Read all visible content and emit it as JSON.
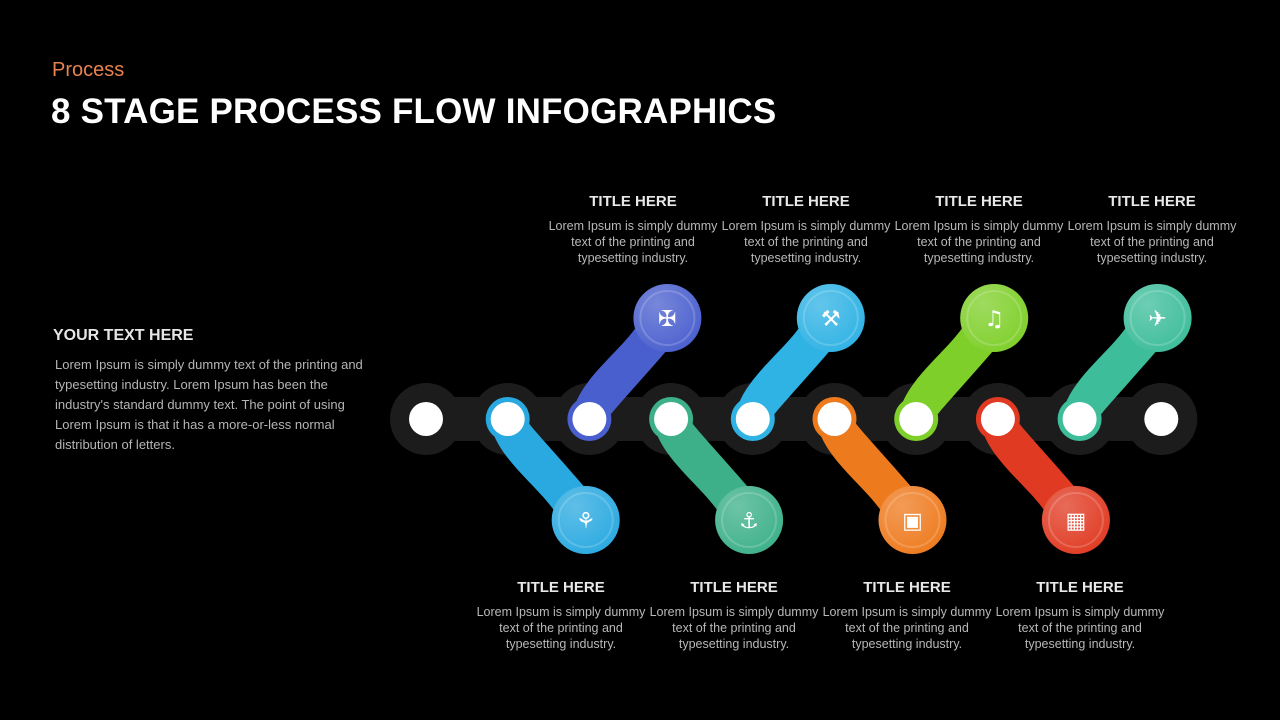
{
  "header": {
    "subtitle": "Process",
    "title": "8 STAGE PROCESS FLOW INFOGRAPHICS"
  },
  "sidebar": {
    "heading": "YOUR TEXT HERE",
    "body": "Lorem Ipsum is simply dummy text of the printing and typesetting industry. Lorem Ipsum has been the industry's standard dummy text. The point of using Lorem Ipsum is that it has a more-or-less normal distribution of letters."
  },
  "stages": [
    {
      "title": "TITLE HERE",
      "body": "Lorem Ipsum is simply dummy text of the printing and typesetting industry.",
      "color": "#2aa9e0",
      "position": "bottom",
      "icon": "plant-in-hand-icon"
    },
    {
      "title": "TITLE HERE",
      "body": "Lorem Ipsum is simply dummy text of the printing and typesetting industry.",
      "color": "#4a5fce",
      "position": "top",
      "icon": "satellite-icon"
    },
    {
      "title": "TITLE HERE",
      "body": "Lorem Ipsum is simply dummy text of the printing and typesetting industry.",
      "color": "#3db08a",
      "position": "bottom",
      "icon": "weightlifter-icon"
    },
    {
      "title": "TITLE HERE",
      "body": "Lorem Ipsum is simply dummy text of the printing and typesetting industry.",
      "color": "#2fb2e4",
      "position": "top",
      "icon": "person-at-desk-icon"
    },
    {
      "title": "TITLE HERE",
      "body": "Lorem Ipsum is simply dummy text of the printing and typesetting industry.",
      "color": "#ee7a1e",
      "position": "bottom",
      "icon": "presentation-icon"
    },
    {
      "title": "TITLE HERE",
      "body": "Lorem Ipsum is simply dummy text of the printing and typesetting industry.",
      "color": "#7fcf2a",
      "position": "top",
      "icon": "megaphone-icon"
    },
    {
      "title": "TITLE HERE",
      "body": "Lorem Ipsum is simply dummy text of the printing and typesetting industry.",
      "color": "#e03a22",
      "position": "bottom",
      "icon": "monitor-chart-icon"
    },
    {
      "title": "TITLE HERE",
      "body": "Lorem Ipsum is simply dummy text of the printing and typesetting industry.",
      "color": "#3dbd9a",
      "position": "top",
      "icon": "rocket-icon"
    }
  ],
  "chain": {
    "track_color": "#1c1c1c",
    "node_color": "#ffffff",
    "node_count": 10
  }
}
